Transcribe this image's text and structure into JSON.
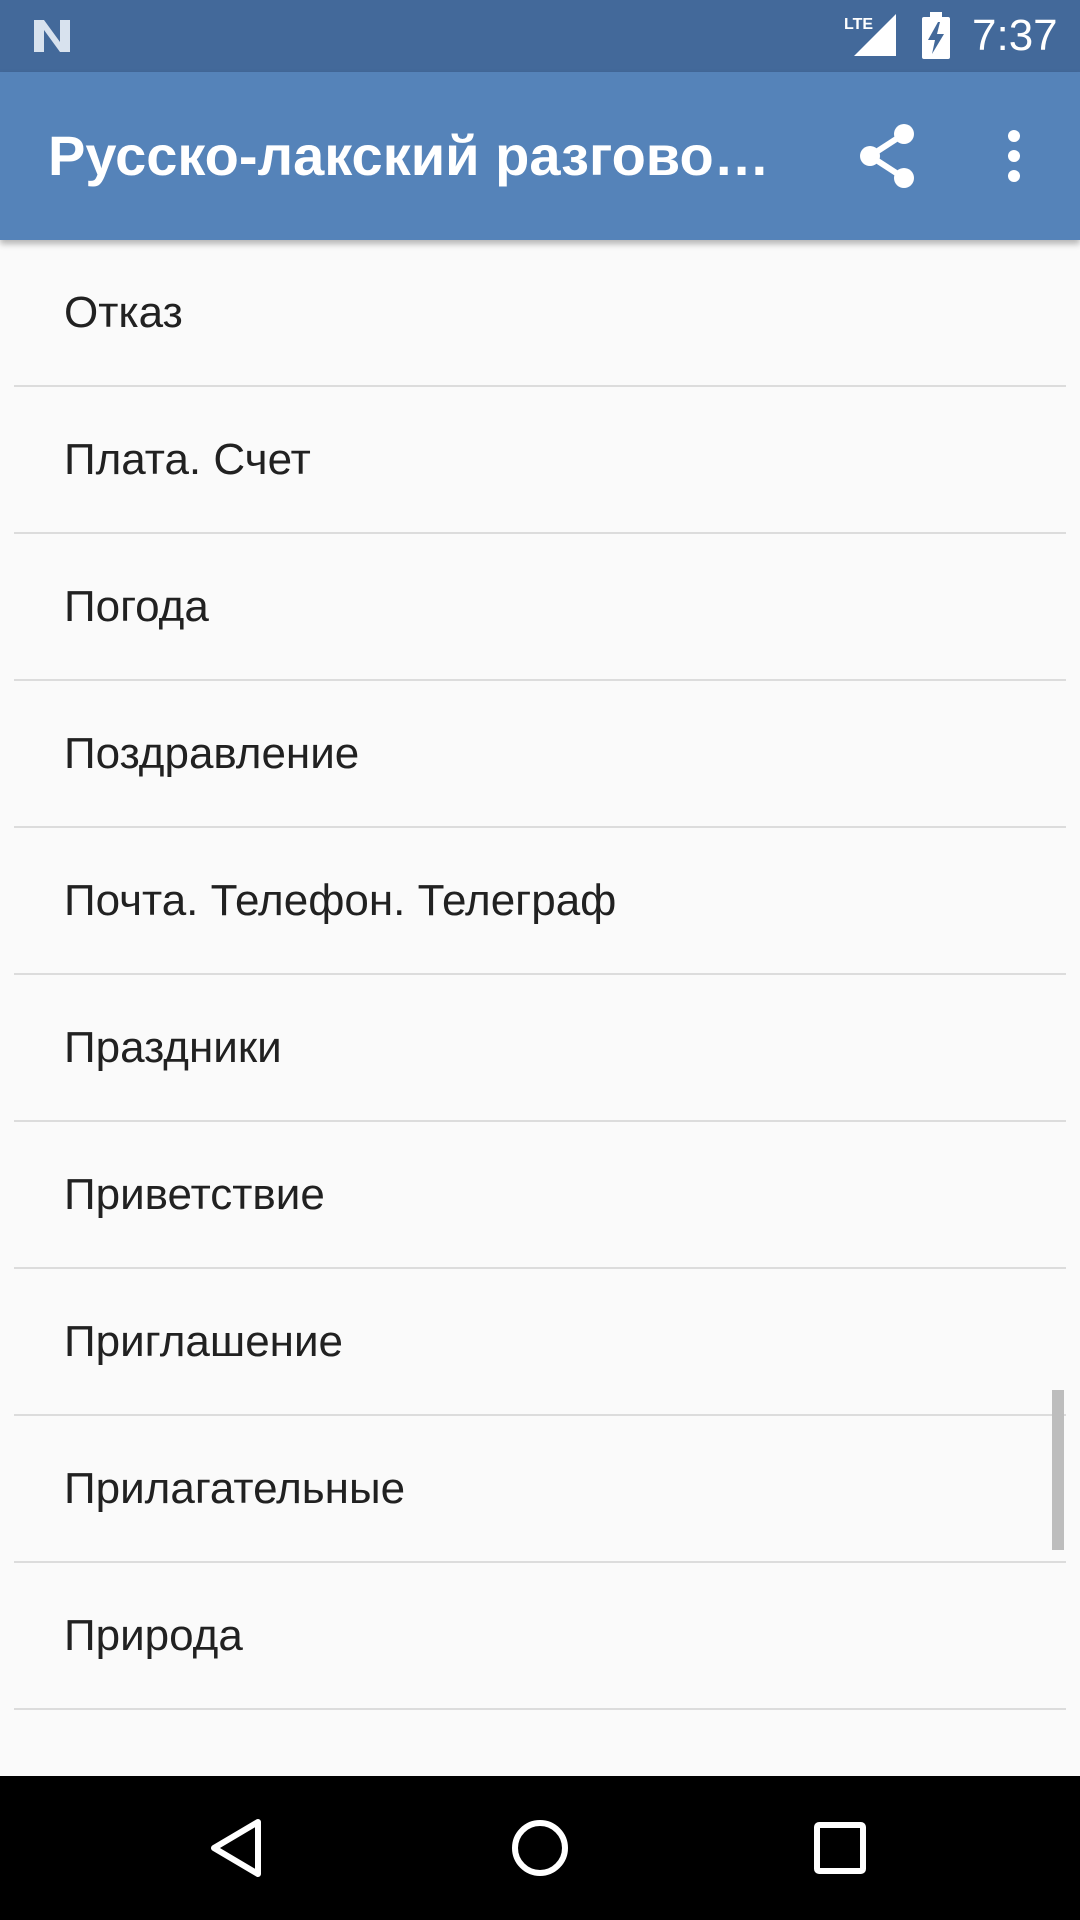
{
  "status_bar": {
    "time": "7:37",
    "network": "LTE",
    "icons": [
      "n-logo-icon",
      "lte-signal-icon",
      "battery-charging-icon"
    ]
  },
  "app_bar": {
    "title": "Русско-лакский разгово…",
    "actions": [
      "share-icon",
      "more-vert-icon"
    ]
  },
  "list": {
    "items": [
      {
        "label": "Отказ"
      },
      {
        "label": "Плата. Счет"
      },
      {
        "label": "Погода"
      },
      {
        "label": "Поздравление"
      },
      {
        "label": "Почта. Телефон. Телеграф"
      },
      {
        "label": "Праздники"
      },
      {
        "label": "Приветствие"
      },
      {
        "label": "Приглашение"
      },
      {
        "label": "Прилагательные"
      },
      {
        "label": "Природа"
      }
    ]
  },
  "nav_bar": {
    "buttons": [
      "back-icon",
      "home-icon",
      "recents-icon"
    ]
  },
  "colors": {
    "status_bar": "#43699a",
    "app_bar": "#5583b9",
    "background": "#fafafa",
    "divider": "#dcdcdc",
    "text": "#212121",
    "nav_bar": "#000000"
  }
}
